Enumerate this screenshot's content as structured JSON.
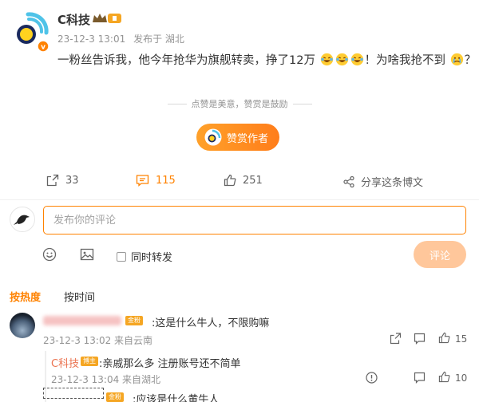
{
  "post": {
    "author": "C科技",
    "timestamp": "23-12-3 13:01",
    "source": "发布于 湖北",
    "text_before": "一粉丝告诉我，他今年抢华为旗舰转卖，挣了12万",
    "text_after": "！为啥我抢不到",
    "text_end": "？"
  },
  "reward": {
    "divider_text": "点赞是美意，赞赏是鼓励",
    "button_label": "赞赏作者"
  },
  "actions": {
    "repost_count": "33",
    "comment_count": "115",
    "like_count": "251",
    "share_label": "分享这条博文"
  },
  "composer": {
    "placeholder": "发布你的评论",
    "repost_label": "同时转发",
    "submit_label": "评论"
  },
  "sort": {
    "hot": "按热度",
    "time": "按时间"
  },
  "comments": [
    {
      "badge": "金粉",
      "text": ":这是什么牛人，不限购嘛",
      "meta": "23-12-3 13:02 来自云南",
      "likes": "15",
      "reply": {
        "author": "C科技",
        "author_badge": "博主",
        "text": ":亲戚那么多 注册账号还不简单",
        "meta": "23-12-3 13:04 来自湖北",
        "likes": "10"
      }
    },
    {
      "badge": "金粉",
      "text": ":应该是什么黄牛人"
    }
  ],
  "colors": {
    "accent": "#ff8200",
    "meta_gray": "#939393",
    "reply_name": "#eb7350"
  },
  "icons": [
    "brand-logo-icon",
    "crown-icon",
    "repost-icon",
    "comment-icon",
    "like-icon",
    "share-icon",
    "emoji-icon",
    "image-icon",
    "reply-icon",
    "comment-reply-icon",
    "thumb-up-icon",
    "report-icon"
  ]
}
